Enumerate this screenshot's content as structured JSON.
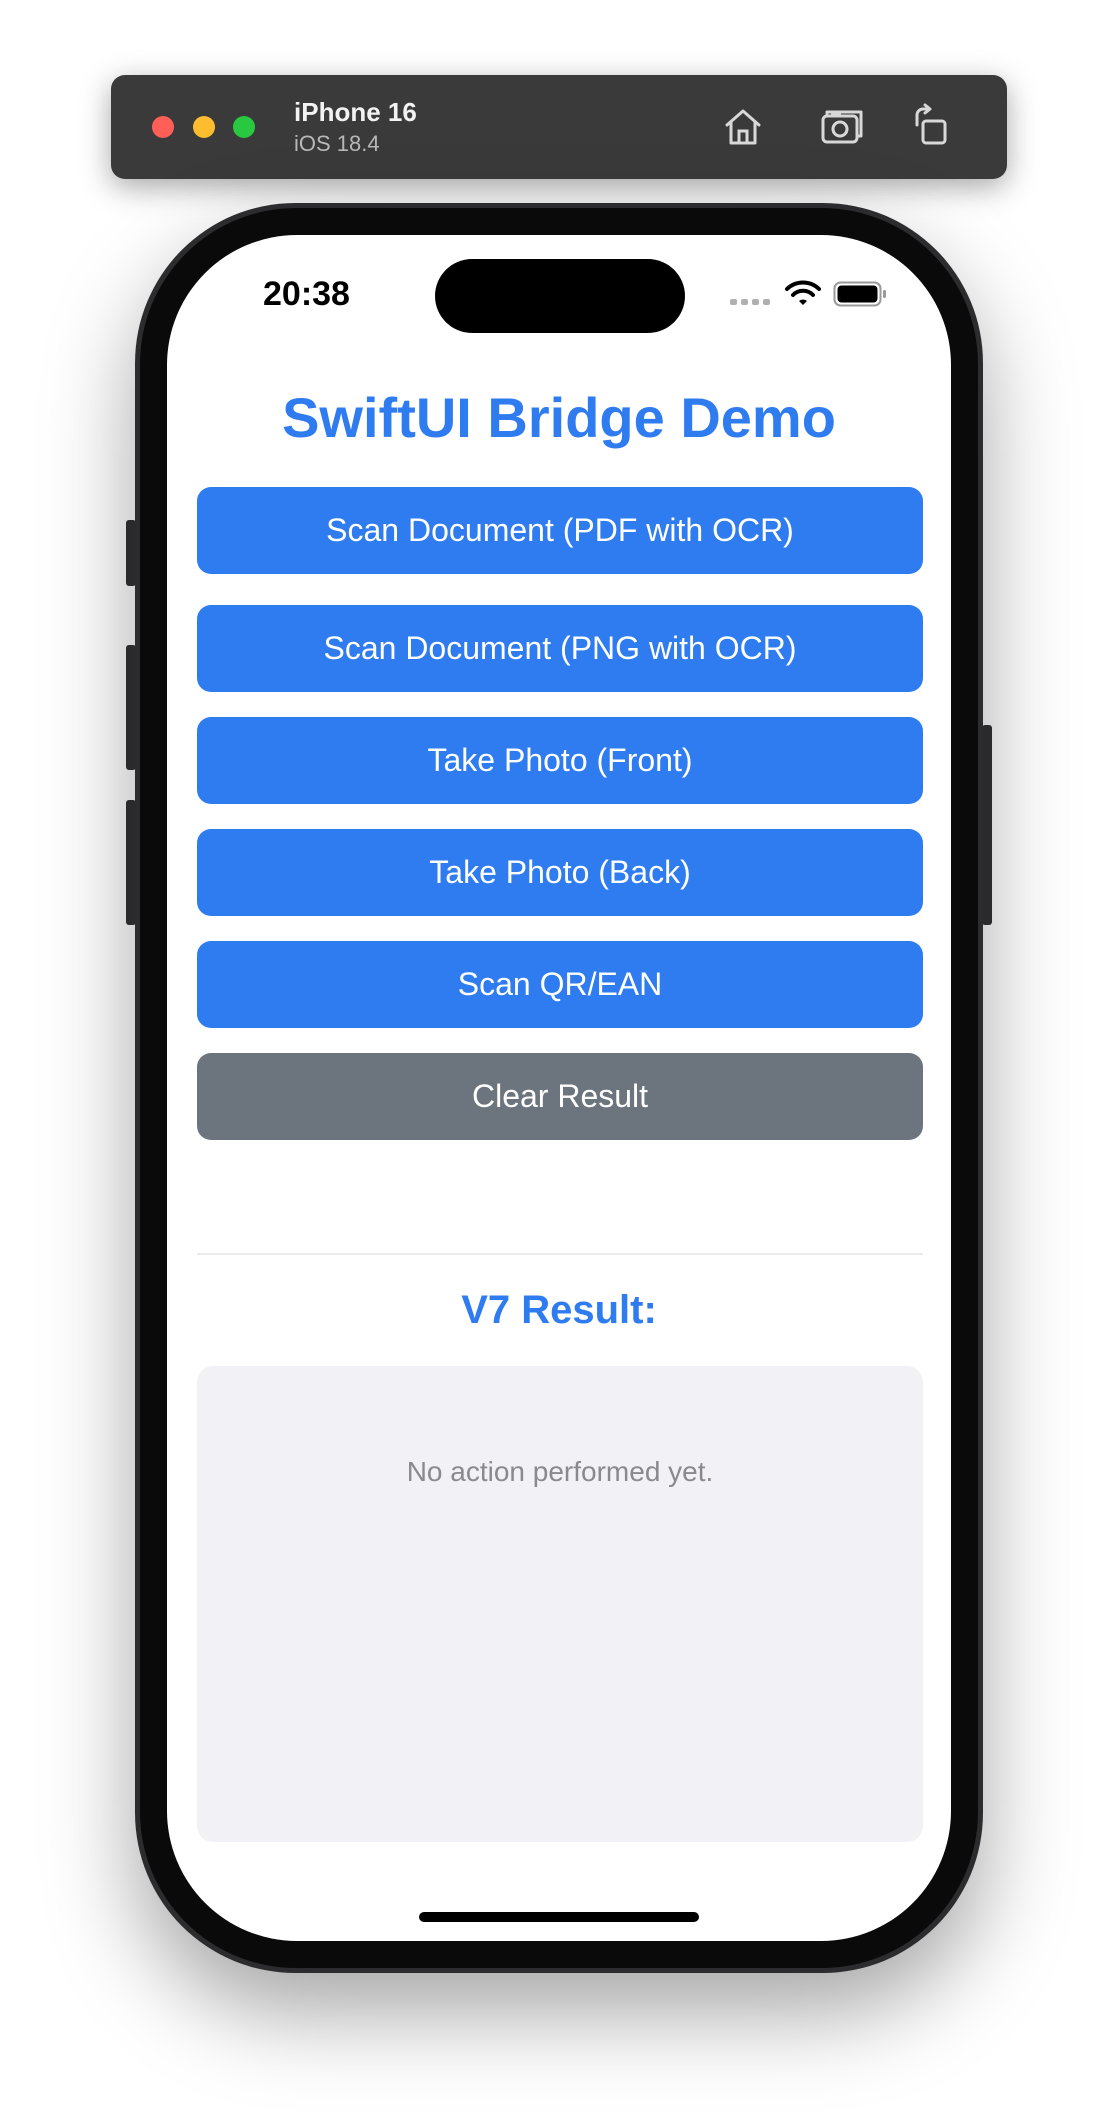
{
  "simulator": {
    "device_name": "iPhone 16",
    "os_version": "iOS 18.4",
    "toolbar_icons": [
      "home-icon",
      "screenshot-icon",
      "rotate-icon"
    ]
  },
  "status_bar": {
    "time": "20:38",
    "icons": [
      "cellular-icon",
      "wifi-icon",
      "battery-icon"
    ]
  },
  "app": {
    "title": "SwiftUI Bridge Demo",
    "buttons": [
      {
        "label": "Scan Document (PDF with OCR)",
        "color": "#2f7bf0"
      },
      {
        "label": "Scan Document (PNG with OCR)",
        "color": "#2f7bf0"
      },
      {
        "label": "Take Photo (Front)",
        "color": "#2f7bf0"
      },
      {
        "label": "Take Photo (Back)",
        "color": "#2f7bf0"
      },
      {
        "label": "Scan QR/EAN",
        "color": "#2f7bf0"
      },
      {
        "label": "Clear Result",
        "color": "#6c757d"
      }
    ],
    "result": {
      "heading": "V7 Result:",
      "text": "No action performed yet."
    }
  },
  "colors": {
    "accent": "#2f7bf0",
    "secondary": "#6c757d",
    "result_background": "#f1f1f6"
  }
}
